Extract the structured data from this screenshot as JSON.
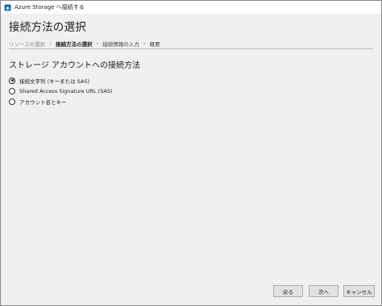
{
  "window": {
    "title": "Azure Storage へ接続する"
  },
  "page": {
    "title": "接続方法の選択"
  },
  "breadcrumb": {
    "items": [
      {
        "label": "リソースの選択",
        "state": "done"
      },
      {
        "label": "接続方法の選択",
        "state": "current"
      },
      {
        "label": "接続情報の入力",
        "state": "pending"
      },
      {
        "label": "概要",
        "state": "pending"
      }
    ]
  },
  "section": {
    "heading": "ストレージ アカウントへの接続方法"
  },
  "options": [
    {
      "label": "接続文字列 (キーまたは SAS)",
      "selected": true
    },
    {
      "label": "Shared Access Signature URL (SAS)",
      "selected": false
    },
    {
      "label": "アカウント名とキー",
      "selected": false
    }
  ],
  "footer": {
    "back_label": "戻る",
    "next_label": "次へ",
    "cancel_label": "キャンセル"
  },
  "colors": {
    "background": "#f0f0f0",
    "titlebar": "#ffffff",
    "button": "#e1e1e1",
    "icon_blue": "#1f6fb5"
  },
  "icons": {
    "app": "azure-storage-plug-icon",
    "breadcrumb_separator": "chevron-right-icon"
  }
}
